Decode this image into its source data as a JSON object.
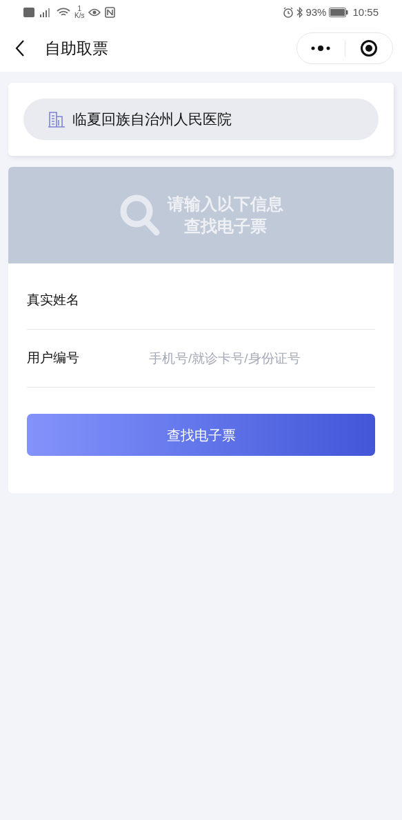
{
  "status_bar": {
    "speed_value": "1",
    "speed_unit": "K/s",
    "battery": "93%",
    "time": "10:55"
  },
  "nav": {
    "title": "自助取票"
  },
  "hospital": {
    "name": "临夏回族自治州人民医院"
  },
  "banner": {
    "lines": [
      "请输入以下信息",
      "查找电子票"
    ]
  },
  "form": {
    "fields": [
      {
        "label": "真实姓名"
      },
      {
        "label": "用户编号",
        "placeholder": "手机号/就诊卡号/身份证号"
      }
    ],
    "submit": "查找电子票"
  }
}
